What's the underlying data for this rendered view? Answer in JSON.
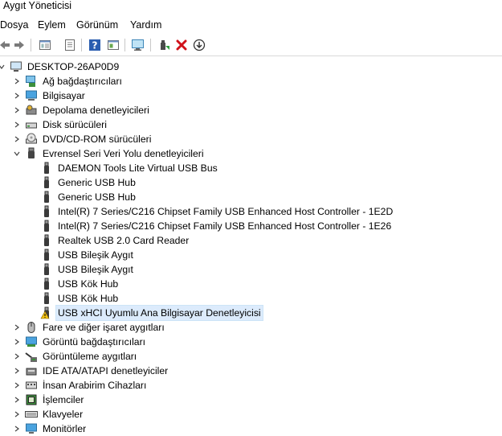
{
  "window": {
    "title": "Aygıt Yöneticisi"
  },
  "menu": [
    "Dosya",
    "Eylem",
    "Görünüm",
    "Yardım"
  ],
  "toolbar": {
    "buttons": [
      "back-arrow-icon",
      "forward-arrow-icon",
      "properties-view-icon",
      "list-view-icon",
      "help-icon",
      "console-view-icon",
      "monitor-scan-icon",
      "update-driver-icon",
      "uninstall-x-icon",
      "download-icon"
    ]
  },
  "tree": {
    "root": "DESKTOP-26AP0D9",
    "categories_before": [
      {
        "label": "Ağ bağdaştırıcıları",
        "icon": "network-adapter-icon"
      },
      {
        "label": "Bilgisayar",
        "icon": "computer-icon"
      },
      {
        "label": "Depolama denetleyicileri",
        "icon": "storage-controller-icon"
      },
      {
        "label": "Disk sürücüleri",
        "icon": "disk-drive-icon"
      },
      {
        "label": "DVD/CD-ROM sürücüleri",
        "icon": "dvd-icon"
      }
    ],
    "usb_category": "Evrensel Seri Veri Yolu denetleyicileri",
    "usb_children": [
      {
        "label": "DAEMON Tools Lite Virtual USB Bus",
        "warning": false
      },
      {
        "label": "Generic USB Hub",
        "warning": false
      },
      {
        "label": "Generic USB Hub",
        "warning": false
      },
      {
        "label": "Intel(R) 7 Series/C216 Chipset Family USB Enhanced Host Controller - 1E2D",
        "warning": false
      },
      {
        "label": "Intel(R) 7 Series/C216 Chipset Family USB Enhanced Host Controller - 1E26",
        "warning": false
      },
      {
        "label": "Realtek USB 2.0 Card Reader",
        "warning": false
      },
      {
        "label": "USB Bileşik Aygıt",
        "warning": false
      },
      {
        "label": "USB Bileşik Aygıt",
        "warning": false
      },
      {
        "label": "USB Kök Hub",
        "warning": false
      },
      {
        "label": "USB Kök Hub",
        "warning": false
      },
      {
        "label": "USB xHCI Uyumlu Ana Bilgisayar Denetleyicisi",
        "warning": true
      }
    ],
    "categories_after": [
      {
        "label": "Fare ve diğer işaret aygıtları",
        "icon": "mouse-icon"
      },
      {
        "label": "Görüntü bağdaştırıcıları",
        "icon": "display-adapter-icon"
      },
      {
        "label": "Görüntüleme aygıtları",
        "icon": "imaging-device-icon"
      },
      {
        "label": "IDE ATA/ATAPI denetleyiciler",
        "icon": "ide-controller-icon"
      },
      {
        "label": "İnsan Arabirim Cihazları",
        "icon": "hid-icon"
      },
      {
        "label": "İşlemciler",
        "icon": "processor-icon"
      },
      {
        "label": "Klavyeler",
        "icon": "keyboard-icon"
      },
      {
        "label": "Monitörler",
        "icon": "monitor-icon"
      }
    ]
  }
}
